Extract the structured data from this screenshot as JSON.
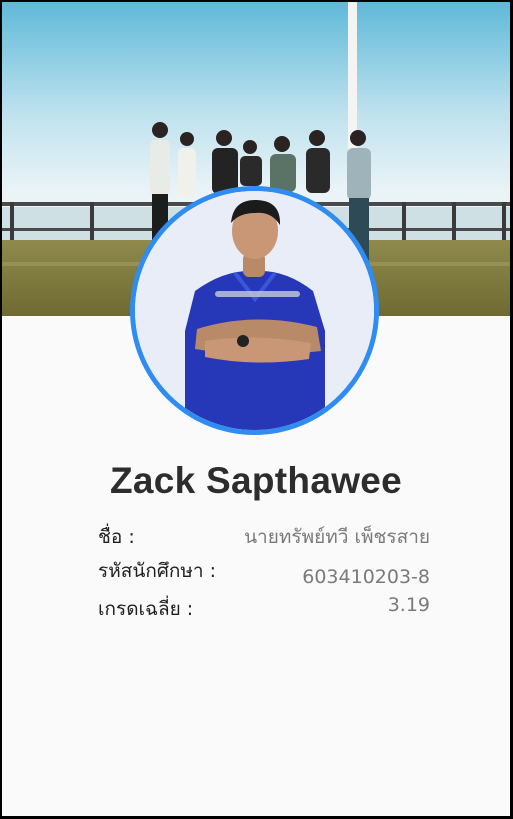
{
  "profile": {
    "full_name": "Zack Sapthawee",
    "fields": [
      {
        "label": "ชื่อ :",
        "value": "นายทรัพย์ทวี เพ็ชรสาย"
      },
      {
        "label": "รหัสนักศึกษา :",
        "value": "603410203-8"
      },
      {
        "label": "เกรดเฉลี่ย :",
        "value": "3.19"
      }
    ]
  },
  "colors": {
    "avatar_border": "#2f8cf0",
    "scrub_blue": "#2638b8",
    "background": "#fafafa"
  }
}
